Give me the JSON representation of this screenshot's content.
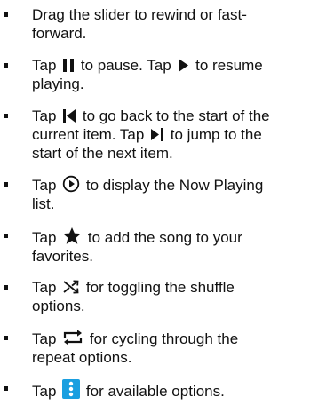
{
  "bullets": [
    {
      "lines": [
        "Drag the slider to rewind or fast-",
        "forward."
      ]
    },
    {
      "lines": [
        "to pause. Tap",
        "to resume",
        "playing."
      ],
      "tap": "Tap",
      "icons": [
        "pause-icon",
        "play-icon"
      ]
    },
    {
      "tap": "Tap",
      "icons": [
        "skip-previous-icon",
        "skip-next-icon"
      ],
      "parts": [
        "to go back to the start of the",
        "current item. Tap",
        "to jump to the",
        "start of the next item."
      ]
    },
    {
      "tap": "Tap",
      "icons": [
        "now-playing-icon"
      ],
      "parts": [
        "to display the Now Playing",
        "list."
      ]
    },
    {
      "tap": "Tap",
      "icons": [
        "star-icon"
      ],
      "parts": [
        "to add the song to your",
        "favorites."
      ]
    },
    {
      "tap": "Tap",
      "icons": [
        "shuffle-icon"
      ],
      "parts": [
        "for toggling the shuffle",
        "options."
      ]
    },
    {
      "tap": "Tap",
      "icons": [
        "repeat-icon"
      ],
      "parts": [
        "for cycling through the",
        "repeat options."
      ]
    },
    {
      "tap": "Tap",
      "icons": [
        "more-options-icon"
      ],
      "parts": [
        "for available options."
      ]
    }
  ],
  "colors": {
    "text": "#111111",
    "accent": "#1a9fe0"
  }
}
